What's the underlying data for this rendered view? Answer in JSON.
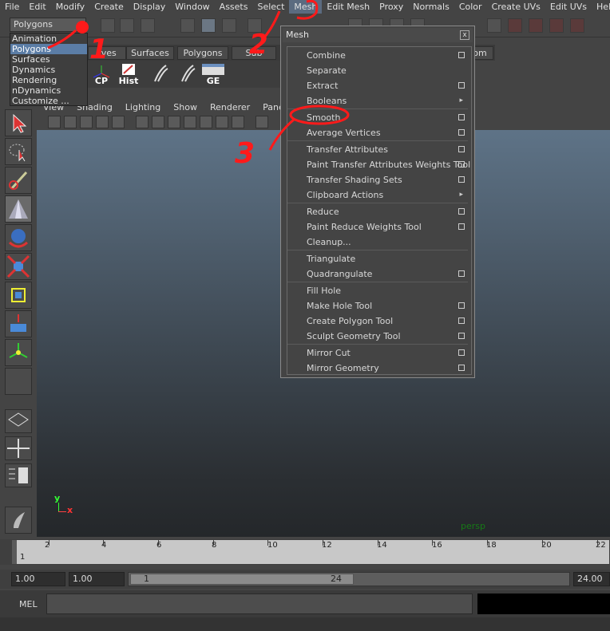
{
  "menubar": [
    "File",
    "Edit",
    "Modify",
    "Create",
    "Display",
    "Window",
    "Assets",
    "Select",
    "Mesh",
    "Edit Mesh",
    "Proxy",
    "Normals",
    "Color",
    "Create UVs",
    "Edit UVs",
    "Help"
  ],
  "mode_selector": {
    "value": "Polygons",
    "options": [
      "Animation",
      "Polygons",
      "Surfaces",
      "Dynamics",
      "Rendering",
      "nDynamics",
      "Customize ..."
    ],
    "selected": "Polygons"
  },
  "shelf": {
    "tabs": [
      "rves",
      "Surfaces",
      "Polygons",
      "Sub"
    ],
    "extra_tab": "om",
    "icons": [
      "CP",
      "Hist",
      "",
      "",
      "GE"
    ]
  },
  "panel_menu": [
    "View",
    "Shading",
    "Lighting",
    "Show",
    "Renderer",
    "Panels"
  ],
  "mesh_menu": {
    "title": "Mesh",
    "close": "x",
    "items": [
      {
        "label": "Combine",
        "option": true
      },
      {
        "label": "Separate"
      },
      {
        "label": "Extract",
        "option": true
      },
      {
        "label": "Booleans",
        "submenu": true
      },
      {
        "label": "Smooth",
        "option": true
      },
      {
        "label": "Average Vertices",
        "option": true
      },
      {
        "label": "Transfer Attributes",
        "option": true
      },
      {
        "label": "Paint Transfer Attributes Weights Tool",
        "option": true
      },
      {
        "label": "Transfer Shading Sets",
        "option": true
      },
      {
        "label": "Clipboard Actions",
        "submenu": true
      },
      {
        "label": "Reduce",
        "option": true
      },
      {
        "label": "Paint Reduce Weights Tool",
        "option": true
      },
      {
        "label": "Cleanup..."
      },
      {
        "label": "Triangulate"
      },
      {
        "label": "Quadrangulate",
        "option": true
      },
      {
        "label": "Fill Hole"
      },
      {
        "label": "Make Hole Tool",
        "option": true
      },
      {
        "label": "Create Polygon Tool",
        "option": true
      },
      {
        "label": "Sculpt Geometry Tool",
        "option": true
      },
      {
        "label": "Mirror Cut",
        "option": true
      },
      {
        "label": "Mirror Geometry",
        "option": true
      }
    ]
  },
  "viewport": {
    "label": "persp",
    "axis_y": "y",
    "axis_x": "x"
  },
  "timeline": {
    "ticks": [
      "2",
      "4",
      "6",
      "8",
      "10",
      "12",
      "14",
      "16",
      "18",
      "20",
      "22"
    ],
    "current": "1"
  },
  "range": {
    "start": "1.00",
    "playback_start": "1.00",
    "slider_start": "1",
    "slider_end": "24",
    "end": "24.00"
  },
  "command_line": {
    "label": "MEL"
  },
  "annotations": [
    "1",
    "2",
    "3"
  ]
}
